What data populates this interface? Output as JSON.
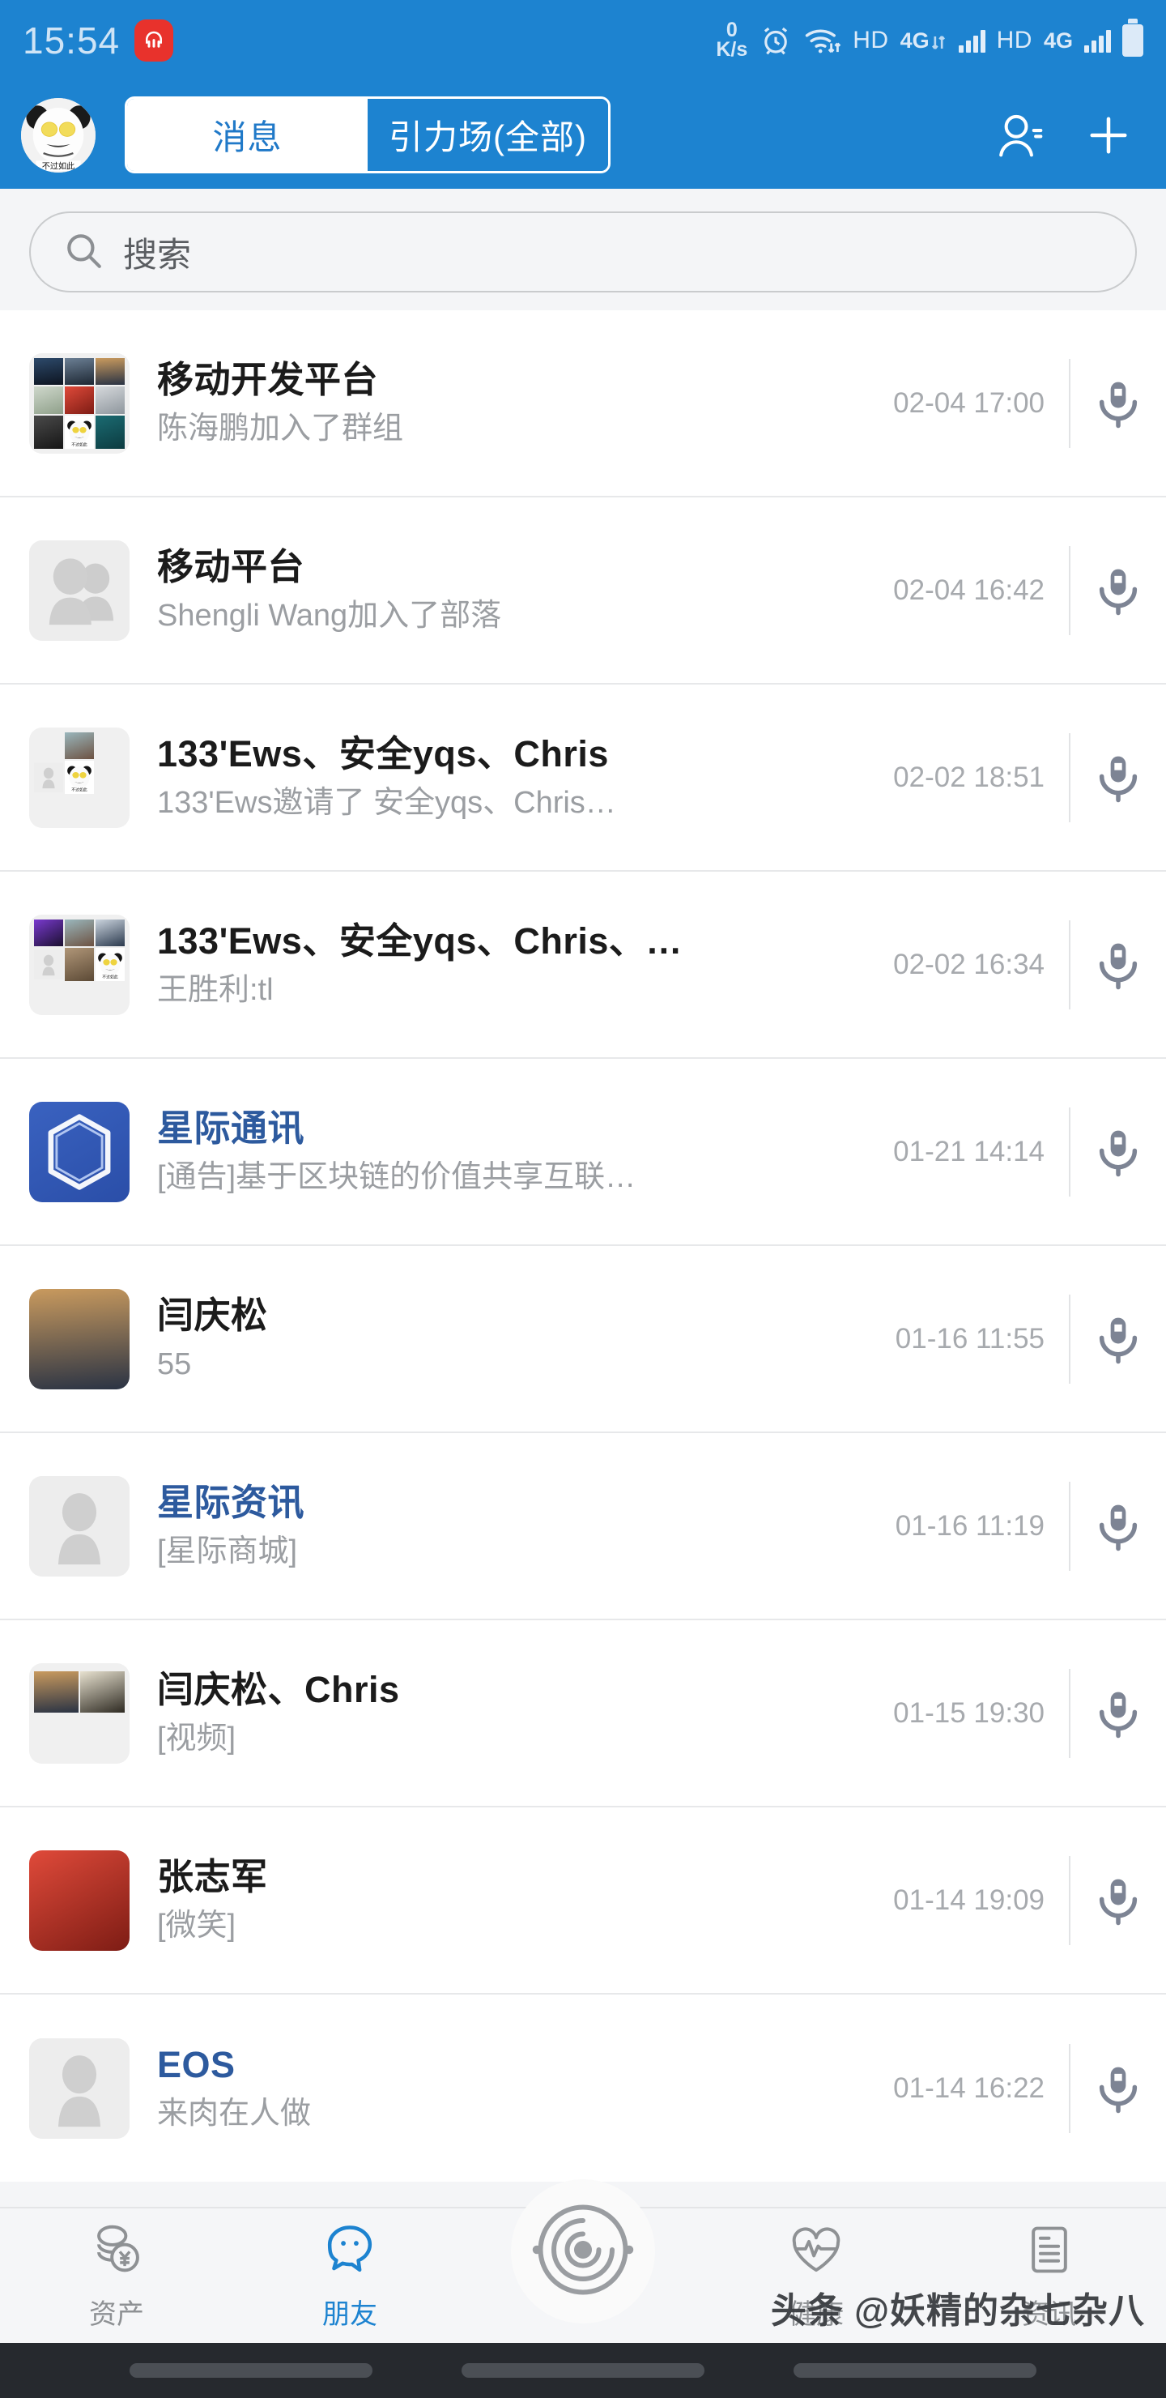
{
  "status_bar": {
    "time": "15:54",
    "headset_icon": "headset-icon",
    "net_speed_value": "0",
    "net_speed_unit": "K/s",
    "alarm_icon": "alarm-icon",
    "wifi_icon": "wifi-icon",
    "hd1_label": "HD",
    "g4_label_1": "4G",
    "hd2_label": "HD",
    "g4_label_2": "4G",
    "battery_icon": "battery-icon"
  },
  "header": {
    "avatar_name": "panda-avatar",
    "avatar_caption": "不过如此",
    "tabs": [
      {
        "label": "消息",
        "active": true
      },
      {
        "label": "引力场(全部)",
        "active": false
      }
    ],
    "contacts_icon": "add-contact-icon",
    "plus_icon": "plus-icon"
  },
  "search": {
    "icon": "search-icon",
    "placeholder": "搜索",
    "value": ""
  },
  "colors": {
    "brand_blue": "#1d83d0",
    "link_blue": "#2d5a9e",
    "mic_gray": "#7d8494",
    "subtitle_gray": "#9b9ea2",
    "time_gray": "#a7aaae",
    "tab_active": "#1d83d0"
  },
  "conversations": [
    {
      "title": "移动开发平台",
      "title_link": false,
      "subtitle": "陈海鹏加入了群组",
      "time": "02-04 17:00",
      "avatar_type": "grid9",
      "mic_icon": "microphone-icon"
    },
    {
      "title": "移动平台",
      "title_link": false,
      "subtitle": "Shengli Wang加入了部落",
      "time": "02-04 16:42",
      "avatar_type": "people-placeholder",
      "mic_icon": "microphone-icon"
    },
    {
      "title": "133'Ews、安全yqs、Chris",
      "title_link": false,
      "subtitle": "133'Ews邀请了 安全yqs、Chris…",
      "time": "02-02 18:51",
      "avatar_type": "grid3",
      "mic_icon": "microphone-icon"
    },
    {
      "title": "133'Ews、安全yqs、Chris、…",
      "title_link": false,
      "subtitle": "王胜利:tl",
      "time": "02-02 16:34",
      "avatar_type": "grid6",
      "mic_icon": "microphone-icon"
    },
    {
      "title": "星际通讯",
      "title_link": true,
      "subtitle": "[通告]基于区块链的价值共享互联…",
      "time": "01-21 14:14",
      "avatar_type": "logo-hexagon",
      "mic_icon": "microphone-icon"
    },
    {
      "title": "闫庆松",
      "title_link": false,
      "subtitle": "55",
      "time": "01-16 11:55",
      "avatar_type": "photo-tower",
      "mic_icon": "microphone-icon"
    },
    {
      "title": "星际资讯",
      "title_link": true,
      "subtitle": "[星际商城]",
      "time": "01-16 11:19",
      "avatar_type": "person-placeholder",
      "mic_icon": "microphone-icon"
    },
    {
      "title": "闫庆松、Chris",
      "title_link": false,
      "subtitle": "[视频]",
      "time": "01-15 19:30",
      "avatar_type": "grid2",
      "mic_icon": "microphone-icon"
    },
    {
      "title": "张志军",
      "title_link": false,
      "subtitle": "[微笑]",
      "time": "01-14 19:09",
      "avatar_type": "photo-car",
      "mic_icon": "microphone-icon"
    },
    {
      "title": "EOS",
      "title_link": true,
      "subtitle": "来肉在人做",
      "time": "01-14 16:22",
      "avatar_type": "person-placeholder",
      "mic_icon": "microphone-icon"
    }
  ],
  "tabbar": {
    "items": [
      {
        "label": "资产",
        "icon": "coins-icon",
        "active": false
      },
      {
        "label": "朋友",
        "icon": "chat-ghost-icon",
        "active": true
      },
      {
        "label": "",
        "icon": "spiral-icon",
        "active": false
      },
      {
        "label": "健康",
        "icon": "heart-pulse-icon",
        "active": false
      },
      {
        "label": "资讯",
        "icon": "news-document-icon",
        "active": false
      }
    ]
  },
  "watermark": "头条 @妖精的杂七杂八"
}
